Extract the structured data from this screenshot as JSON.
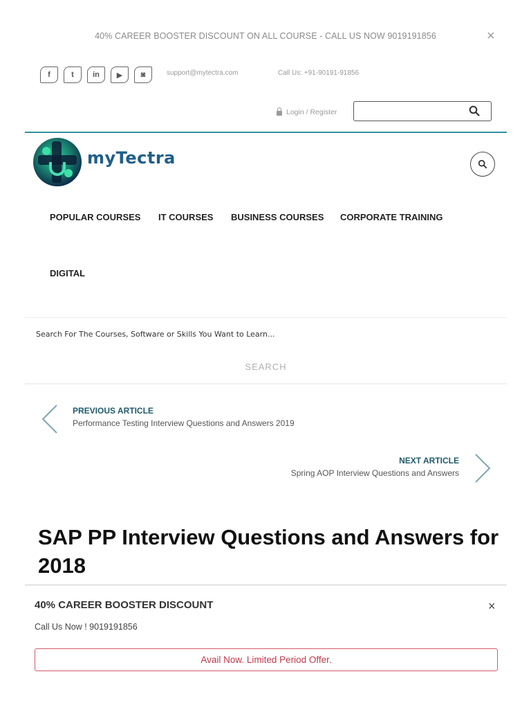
{
  "topbar": {
    "announcement": "40% CAREER BOOSTER DISCOUNT ON ALL COURSE - CALL US NOW 9019191856",
    "close_label": "×"
  },
  "social_icons": [
    "facebook-icon",
    "twitter-icon",
    "linkedin-icon",
    "youtube-icon",
    "instagram-icon"
  ],
  "social_glyphs": {
    "facebook": "f",
    "twitter": "t",
    "linkedin": "in",
    "youtube": "▶",
    "instagram": "◙"
  },
  "contact": {
    "email": "support@mytectra.com",
    "phone": "Call Us: +91-90191-91856"
  },
  "header": {
    "login_label": "Login / Register",
    "search_value": "",
    "brand_name": "myTectra"
  },
  "nav": {
    "items": [
      "POPULAR COURSES",
      "IT COURSES",
      "BUSINESS COURSES",
      "CORPORATE TRAINING",
      "DIGITAL"
    ]
  },
  "course_search": {
    "placeholder": "Search For The Courses, Software or Skills You Want to Learn...",
    "button_label": "SEARCH"
  },
  "articles": {
    "previous_label": "PREVIOUS ARTICLE",
    "previous_title": "Performance Testing Interview Questions and Answers 2019",
    "next_label": "NEXT ARTICLE",
    "next_title": "Spring AOP Interview Questions and Answers"
  },
  "page": {
    "title": "SAP PP Interview Questions and Answers for 2018"
  },
  "popup": {
    "title": "40% CAREER BOOSTER DISCOUNT",
    "subtitle": "Call Us Now ! 9019191856",
    "button_label": "Avail Now. Limited Period Offer.",
    "close_label": "×"
  },
  "colors": {
    "accent_teal": "#2f8fa3",
    "article_label": "#1f5a6a",
    "offer_red": "#c0394b"
  }
}
